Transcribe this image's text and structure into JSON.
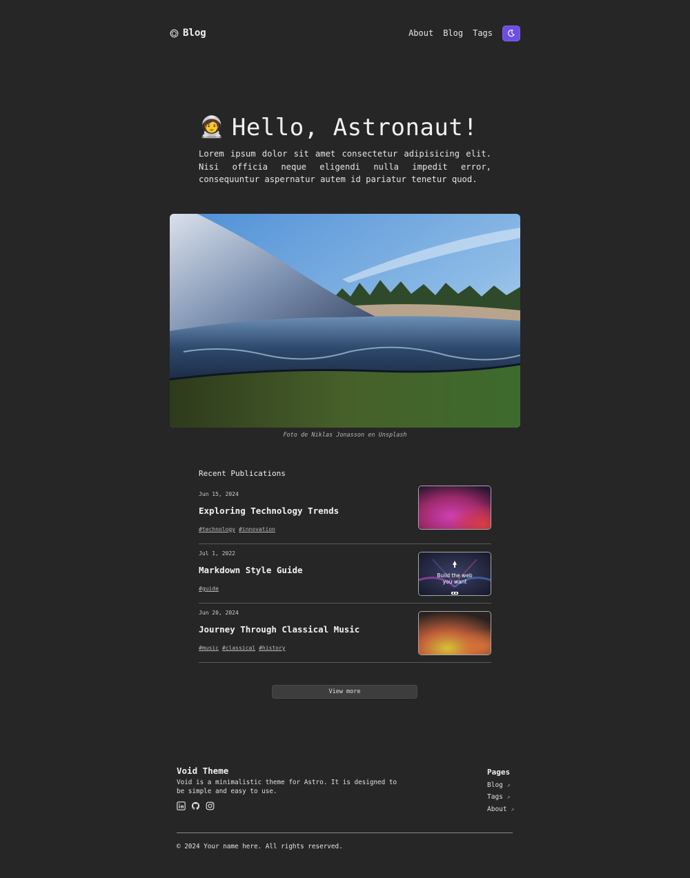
{
  "header": {
    "logo_text": "Blog",
    "nav": [
      {
        "label": "About"
      },
      {
        "label": "Blog"
      },
      {
        "label": "Tags"
      }
    ],
    "theme_toggle_icon": "moon-stars-icon",
    "accent_color": "#6d4fe0"
  },
  "hero": {
    "emoji": "🧑‍🚀",
    "title": "Hello, Astronaut!",
    "text": "Lorem ipsum dolor sit amet consectetur adipisicing elit. Nisi officia neque eligendi nulla impedit error, consequuntur aspernatur autem id pariatur tenetur quod."
  },
  "photo": {
    "caption": "Foto de Niklas Jonasson en Unsplash"
  },
  "recent": {
    "title": "Recent Publications",
    "posts": [
      {
        "date": "Jun 15, 2024",
        "title": "Exploring Technology Trends",
        "tags": [
          "#technology",
          "#innovation"
        ]
      },
      {
        "date": "Jul 1, 2022",
        "title": "Markdown Style Guide",
        "tags": [
          "#guide"
        ],
        "thumb_text_1": "Build the web",
        "thumb_text_2": "you want"
      },
      {
        "date": "Jun 20, 2024",
        "title": "Journey Through Classical Music",
        "tags": [
          "#music",
          "#classical",
          "#history"
        ]
      }
    ]
  },
  "view_more": "View more",
  "footer": {
    "title": "Void Theme",
    "description": "Void is a minimalistic theme for Astro. It is designed to be simple and easy to use.",
    "socials": [
      "linkedin-icon",
      "github-icon",
      "instagram-icon"
    ],
    "pages_title": "Pages",
    "pages": [
      {
        "label": "Blog",
        "arrow": "↗"
      },
      {
        "label": "Tags",
        "arrow": "↗"
      },
      {
        "label": "About",
        "arrow": "↗"
      }
    ],
    "copyright": "© 2024 Your name here. All rights reserved."
  }
}
